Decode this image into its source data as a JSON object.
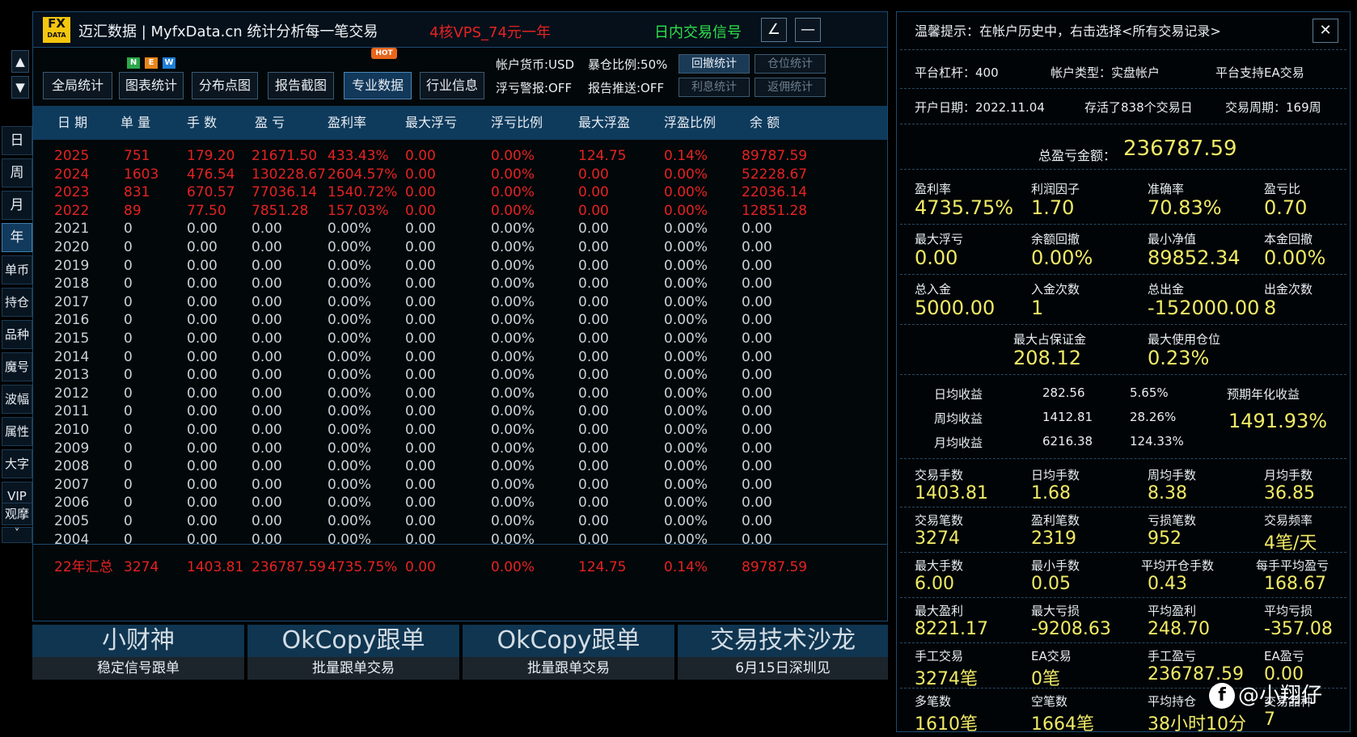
{
  "nav": {
    "up": "▲",
    "down": "▼",
    "items": [
      "日",
      "周",
      "月",
      "年",
      "单币",
      "持仓",
      "品种",
      "魔号",
      "波幅",
      "属性",
      "大字",
      "VIP",
      "观摩"
    ],
    "more": "˅"
  },
  "titlebar": {
    "logo_top": "FX",
    "logo_bottom": "DATA",
    "title": "迈汇数据 | MyfxData.cn  统计分析每一笔交易",
    "promo": "4核VPS_74元一年",
    "signal": "日内交易信号",
    "edit": "∠",
    "minimize": "—"
  },
  "toolbar": {
    "buttons": [
      "全局统计",
      "图表统计",
      "分布点图",
      "报告截图",
      "专业数据",
      "行业信息"
    ],
    "new_badges": [
      "N",
      "E",
      "W"
    ],
    "hot_badge": "HOT",
    "info": [
      "帐户货币:USD",
      "暴仓比例:50%",
      "浮亏警报:OFF",
      "报告推送:OFF"
    ],
    "small_buttons": [
      "回撤统计",
      "仓位统计",
      "利息统计",
      "返佣统计"
    ]
  },
  "table": {
    "headers": [
      "日 期",
      "单 量",
      "手 数",
      "盈 亏",
      "盈利率",
      "最大浮亏",
      "浮亏比例",
      "最大浮盈",
      "浮盈比例",
      "余 额"
    ],
    "rows": [
      [
        "2025",
        "751",
        "179.20",
        "21671.50",
        "433.43%",
        "0.00",
        "0.00%",
        "124.75",
        "0.14%",
        "89787.59"
      ],
      [
        "2024",
        "1603",
        "476.54",
        "130228.67",
        "2604.57%",
        "0.00",
        "0.00%",
        "0.00",
        "0.00%",
        "52228.67"
      ],
      [
        "2023",
        "831",
        "670.57",
        "77036.14",
        "1540.72%",
        "0.00",
        "0.00%",
        "0.00",
        "0.00%",
        "22036.14"
      ],
      [
        "2022",
        "89",
        "77.50",
        "7851.28",
        "157.03%",
        "0.00",
        "0.00%",
        "0.00",
        "0.00%",
        "12851.28"
      ],
      [
        "2021",
        "0",
        "0.00",
        "0.00",
        "0.00%",
        "0.00",
        "0.00%",
        "0.00",
        "0.00%",
        "0.00"
      ],
      [
        "2020",
        "0",
        "0.00",
        "0.00",
        "0.00%",
        "0.00",
        "0.00%",
        "0.00",
        "0.00%",
        "0.00"
      ],
      [
        "2019",
        "0",
        "0.00",
        "0.00",
        "0.00%",
        "0.00",
        "0.00%",
        "0.00",
        "0.00%",
        "0.00"
      ],
      [
        "2018",
        "0",
        "0.00",
        "0.00",
        "0.00%",
        "0.00",
        "0.00%",
        "0.00",
        "0.00%",
        "0.00"
      ],
      [
        "2017",
        "0",
        "0.00",
        "0.00",
        "0.00%",
        "0.00",
        "0.00%",
        "0.00",
        "0.00%",
        "0.00"
      ],
      [
        "2016",
        "0",
        "0.00",
        "0.00",
        "0.00%",
        "0.00",
        "0.00%",
        "0.00",
        "0.00%",
        "0.00"
      ],
      [
        "2015",
        "0",
        "0.00",
        "0.00",
        "0.00%",
        "0.00",
        "0.00%",
        "0.00",
        "0.00%",
        "0.00"
      ],
      [
        "2014",
        "0",
        "0.00",
        "0.00",
        "0.00%",
        "0.00",
        "0.00%",
        "0.00",
        "0.00%",
        "0.00"
      ],
      [
        "2013",
        "0",
        "0.00",
        "0.00",
        "0.00%",
        "0.00",
        "0.00%",
        "0.00",
        "0.00%",
        "0.00"
      ],
      [
        "2012",
        "0",
        "0.00",
        "0.00",
        "0.00%",
        "0.00",
        "0.00%",
        "0.00",
        "0.00%",
        "0.00"
      ],
      [
        "2011",
        "0",
        "0.00",
        "0.00",
        "0.00%",
        "0.00",
        "0.00%",
        "0.00",
        "0.00%",
        "0.00"
      ],
      [
        "2010",
        "0",
        "0.00",
        "0.00",
        "0.00%",
        "0.00",
        "0.00%",
        "0.00",
        "0.00%",
        "0.00"
      ],
      [
        "2009",
        "0",
        "0.00",
        "0.00",
        "0.00%",
        "0.00",
        "0.00%",
        "0.00",
        "0.00%",
        "0.00"
      ],
      [
        "2008",
        "0",
        "0.00",
        "0.00",
        "0.00%",
        "0.00",
        "0.00%",
        "0.00",
        "0.00%",
        "0.00"
      ],
      [
        "2007",
        "0",
        "0.00",
        "0.00",
        "0.00%",
        "0.00",
        "0.00%",
        "0.00",
        "0.00%",
        "0.00"
      ],
      [
        "2006",
        "0",
        "0.00",
        "0.00",
        "0.00%",
        "0.00",
        "0.00%",
        "0.00",
        "0.00%",
        "0.00"
      ],
      [
        "2005",
        "0",
        "0.00",
        "0.00",
        "0.00%",
        "0.00",
        "0.00%",
        "0.00",
        "0.00%",
        "0.00"
      ],
      [
        "2004",
        "0",
        "0.00",
        "0.00",
        "0.00%",
        "0.00",
        "0.00%",
        "0.00",
        "0.00%",
        "0.00"
      ]
    ],
    "summary": [
      "22年汇总",
      "3274",
      "1403.81",
      "236787.59",
      "4735.75%",
      "0.00",
      "0.00%",
      "124.75",
      "0.14%",
      "89787.59"
    ]
  },
  "banners": [
    {
      "title": "小财神",
      "subtitle": "稳定信号跟单"
    },
    {
      "title": "OkCopy跟单",
      "subtitle": "批量跟单交易"
    },
    {
      "title": "OkCopy跟单",
      "subtitle": "批量跟单交易"
    },
    {
      "title": "交易技术沙龙",
      "subtitle": "6月15日深圳见"
    }
  ],
  "right": {
    "tip": "温馨提示：在帐户历史中，右击选择<所有交易记录>",
    "close": "✕",
    "info_row1": [
      "平台杠杆：400",
      "帐户类型：实盘帐户",
      "平台支持EA交易"
    ],
    "info_row2": [
      "开户日期：2022.11.04",
      "存活了838个交易日",
      "交易周期：169周"
    ],
    "total_label": "总盈亏金额：",
    "total_value": "236787.59",
    "stats1": [
      {
        "label": "盈利率",
        "value": "4735.75%"
      },
      {
        "label": "利润因子",
        "value": "1.70"
      },
      {
        "label": "准确率",
        "value": "70.83%"
      },
      {
        "label": "盈亏比",
        "value": "0.70"
      }
    ],
    "stats2": [
      {
        "label": "最大浮亏",
        "value": "0.00"
      },
      {
        "label": "余额回撤",
        "value": "0.00%"
      },
      {
        "label": "最小净值",
        "value": "89852.34"
      },
      {
        "label": "本金回撤",
        "value": "0.00%"
      }
    ],
    "stats3": [
      {
        "label": "总入金",
        "value": "5000.00"
      },
      {
        "label": "入金次数",
        "value": "1"
      },
      {
        "label": "总出金",
        "value": "-152000.00"
      },
      {
        "label": "出金次数",
        "value": "8"
      }
    ],
    "stats4": [
      {
        "label": "最大占保证金",
        "value": "208.12"
      },
      {
        "label": "最大使用仓位",
        "value": "0.23%"
      }
    ],
    "averages": [
      {
        "label": "日均收益",
        "amount": "282.56",
        "pct": "5.65%"
      },
      {
        "label": "周均收益",
        "amount": "1412.81",
        "pct": "28.26%"
      },
      {
        "label": "月均收益",
        "amount": "6216.38",
        "pct": "124.33%"
      }
    ],
    "annual_label": "预期年化收益",
    "annual_value": "1491.93%",
    "stats5": [
      {
        "label": "交易手数",
        "value": "1403.81"
      },
      {
        "label": "日均手数",
        "value": "1.68"
      },
      {
        "label": "周均手数",
        "value": "8.38"
      },
      {
        "label": "月均手数",
        "value": "36.85"
      }
    ],
    "stats6": [
      {
        "label": "交易笔数",
        "value": "3274"
      },
      {
        "label": "盈利笔数",
        "value": "2319"
      },
      {
        "label": "亏损笔数",
        "value": "952"
      },
      {
        "label": "交易频率",
        "value": "4笔/天"
      }
    ],
    "stats7": [
      {
        "label": "最大手数",
        "value": "6.00"
      },
      {
        "label": "最小手数",
        "value": "0.05"
      },
      {
        "label": "平均开仓手数",
        "value": "0.43"
      },
      {
        "label": "每手平均盈亏",
        "value": "168.67"
      }
    ],
    "stats8": [
      {
        "label": "最大盈利",
        "value": "8221.17"
      },
      {
        "label": "最大亏损",
        "value": "-9208.63"
      },
      {
        "label": "平均盈利",
        "value": "248.70"
      },
      {
        "label": "平均亏损",
        "value": "-357.08"
      }
    ],
    "stats9": [
      {
        "label": "手工交易",
        "value": "3274笔"
      },
      {
        "label": "EA交易",
        "value": "0笔"
      },
      {
        "label": "手工盈亏",
        "value": "236787.59"
      },
      {
        "label": "EA盈亏",
        "value": "0.00"
      }
    ],
    "stats10": [
      {
        "label": "多笔数",
        "value": "1610笔"
      },
      {
        "label": "空笔数",
        "value": "1664笔"
      },
      {
        "label": "平均持仓",
        "value": "38小时10分"
      },
      {
        "label": "交易品种",
        "value": "7"
      }
    ]
  },
  "watermark": {
    "icon": "f",
    "text": "@小翔仔"
  }
}
